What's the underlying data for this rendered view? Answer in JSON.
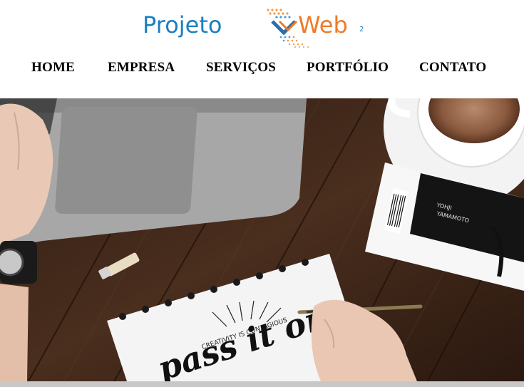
{
  "logo": {
    "text_projeto": "Projeto",
    "text_web": "Web",
    "superscript": "2",
    "colors": {
      "projeto": "#1a7fc1",
      "web": "#f07a26",
      "dots_orange": "#f39a4a",
      "dots_blue": "#4f9fd6"
    }
  },
  "nav": {
    "items": [
      {
        "label": "HOME"
      },
      {
        "label": "EMPRESA"
      },
      {
        "label": "SERVIÇOS"
      },
      {
        "label": "PORTFÓLIO"
      },
      {
        "label": "CONTATO"
      }
    ]
  },
  "hero": {
    "book_text_top": "YOHJI",
    "book_text_bottom": "YAMAMOTO",
    "notebook_text": "CREATIVITY IS CONTAGIOUS",
    "script_text": "pass it on",
    "colors": {
      "wood": "#3a2418",
      "wood_light": "#5a3a28",
      "laptop": "#9b9b9b",
      "paper": "#f4f4f4"
    }
  }
}
